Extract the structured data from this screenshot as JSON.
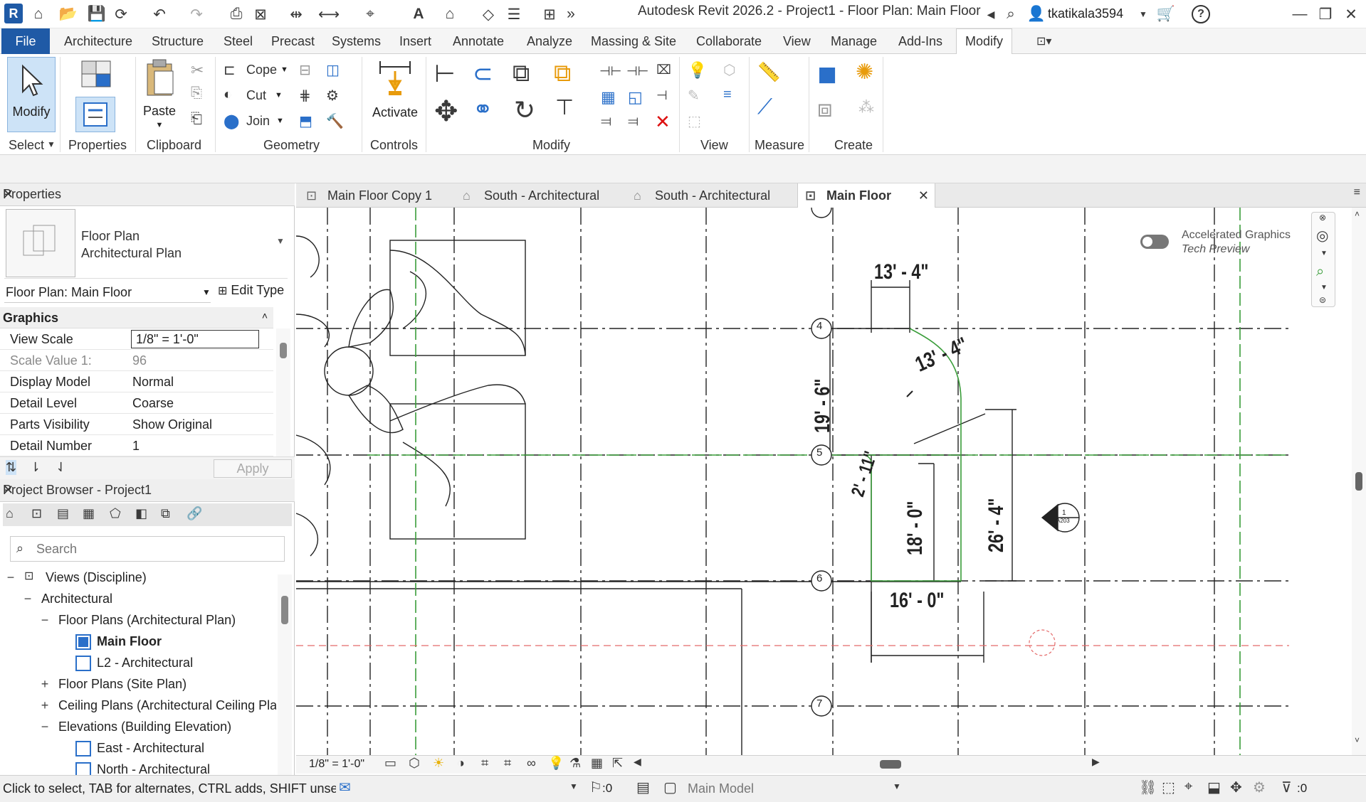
{
  "app": {
    "title": "Autodesk Revit 2026.2 - Project1 - Floor Plan: Main Floor",
    "logo_letter": "R",
    "username": "tkatikala3594"
  },
  "ribbon_tabs": [
    "File",
    "Architecture",
    "Structure",
    "Steel",
    "Precast",
    "Systems",
    "Insert",
    "Annotate",
    "Analyze",
    "Massing & Site",
    "Collaborate",
    "View",
    "Manage",
    "Add-Ins",
    "Modify"
  ],
  "ribbon": {
    "modify_label": "Modify",
    "select_label": "Select",
    "properties_label": "Properties",
    "paste_label": "Paste",
    "clipboard_label": "Clipboard",
    "cope_label": "Cope",
    "cut_label": "Cut",
    "join_label": "Join",
    "geometry_label": "Geometry",
    "activate_label": "Activate",
    "controls_label": "Controls",
    "modify_panel_label": "Modify",
    "view_label": "View",
    "measure_label": "Measure",
    "create_label": "Create"
  },
  "properties": {
    "panel_title": "Properties",
    "type_line1": "Floor Plan",
    "type_line2": "Architectural Plan",
    "instance_selector": "Floor Plan: Main Floor",
    "edit_type": "Edit Type",
    "group": "Graphics",
    "rows": [
      {
        "key": "View Scale",
        "value": "1/8\" = 1'-0\""
      },
      {
        "key": "Scale Value    1:",
        "value": "96"
      },
      {
        "key": "Display Model",
        "value": "Normal"
      },
      {
        "key": "Detail Level",
        "value": "Coarse"
      },
      {
        "key": "Parts Visibility",
        "value": "Show Original"
      },
      {
        "key": "Detail Number",
        "value": "1"
      }
    ],
    "apply": "Apply"
  },
  "browser": {
    "panel_title": "Project Browser - Project1",
    "search_placeholder": "Search",
    "nodes": [
      {
        "toggle": "−",
        "label": "Views (Discipline)"
      },
      {
        "toggle": "−",
        "label": "Architectural"
      },
      {
        "toggle": "−",
        "label": "Floor Plans (Architectural Plan)"
      },
      {
        "toggle": "",
        "label": "Main Floor"
      },
      {
        "toggle": "",
        "label": "L2 - Architectural"
      },
      {
        "toggle": "+",
        "label": "Floor Plans (Site Plan)"
      },
      {
        "toggle": "+",
        "label": "Ceiling Plans (Architectural Ceiling Pla"
      },
      {
        "toggle": "−",
        "label": "Elevations (Building Elevation)"
      },
      {
        "toggle": "",
        "label": "East - Architectural"
      },
      {
        "toggle": "",
        "label": "North - Architectural"
      }
    ]
  },
  "view_tabs": [
    {
      "label": "Main Floor Copy 1",
      "active": false
    },
    {
      "label": "South - Architectural",
      "active": false
    },
    {
      "label": "South - Architectural",
      "active": false
    },
    {
      "label": "Main Floor",
      "active": true
    }
  ],
  "canvas": {
    "accel_line1": "Accelerated Graphics",
    "accel_line2": "Tech Preview",
    "dims": [
      "13' - 4\"",
      "13' - 4\"",
      "19' - 6\"",
      "2' - 11\"",
      "18' - 0\"",
      "26' - 4\"",
      "16' - 0\""
    ],
    "grid_bubbles": [
      "4",
      "5",
      "6",
      "7"
    ],
    "section_tag": "1",
    "section_sheet": "A203"
  },
  "view_control": {
    "scale": "1/8\" = 1'-0\""
  },
  "status": {
    "message": "Click to select, TAB for alternates, CTRL adds, SHIFT unselect",
    "workset_count": ":0",
    "model": "Main Model",
    "filter_count": ":0"
  }
}
